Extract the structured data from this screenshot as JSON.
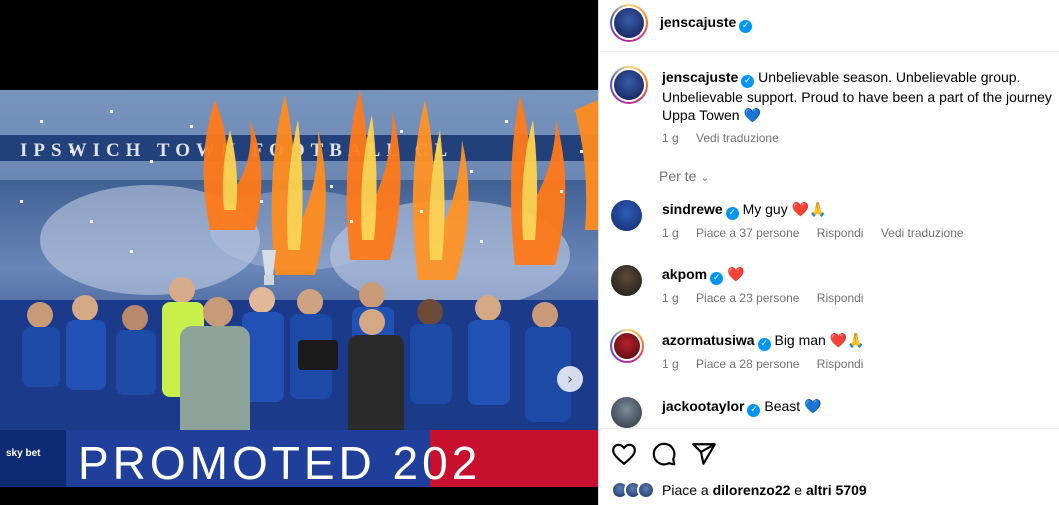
{
  "post": {
    "username": "jenscajuste",
    "caption": "Unbelievable season. Unbelievable group. Unbelievable support. Proud to have been a part of the journey Uppa Towen",
    "caption_emoji": "💙",
    "time": "1 g",
    "see_translation": "Vedi traduzione"
  },
  "photo": {
    "stadium_text": "IPSWICH TOWN FOOTBALL CL",
    "banner_text": "PROMOTED 202",
    "sponsor": "sky bet"
  },
  "for_you_label": "Per te",
  "comments": [
    {
      "username": "sindrewe",
      "text": "My guy",
      "emoji": "❤️🙏",
      "time": "1 g",
      "likes": "Piace a 37 persone",
      "reply": "Rispondi",
      "translate": "Vedi traduzione"
    },
    {
      "username": "akpom",
      "text": "",
      "emoji": "❤️",
      "time": "1 g",
      "likes": "Piace a 23 persone",
      "reply": "Rispondi",
      "translate": ""
    },
    {
      "username": "azormatusiwa",
      "text": "Big man",
      "emoji": "❤️🙏",
      "time": "1 g",
      "likes": "Piace a 28 persone",
      "reply": "Rispondi",
      "translate": ""
    },
    {
      "username": "jackootaylor",
      "text": "Beast",
      "emoji": "💙",
      "time": "",
      "likes": "",
      "reply": "",
      "translate": ""
    }
  ],
  "likes_summary": {
    "prefix": "Piace a ",
    "user": "dilorenzo22",
    "middle": " e ",
    "others": "altri 5709"
  },
  "icons": [
    "like-heart-icon",
    "comment-icon",
    "share-icon",
    "verified-badge-icon",
    "chevron-down-icon",
    "next-arrow-icon"
  ],
  "colors": {
    "verified": "#0095f6",
    "secondary_text": "#737373",
    "heart_red": "#ed1c24",
    "heart_blue": "#1877f2"
  }
}
